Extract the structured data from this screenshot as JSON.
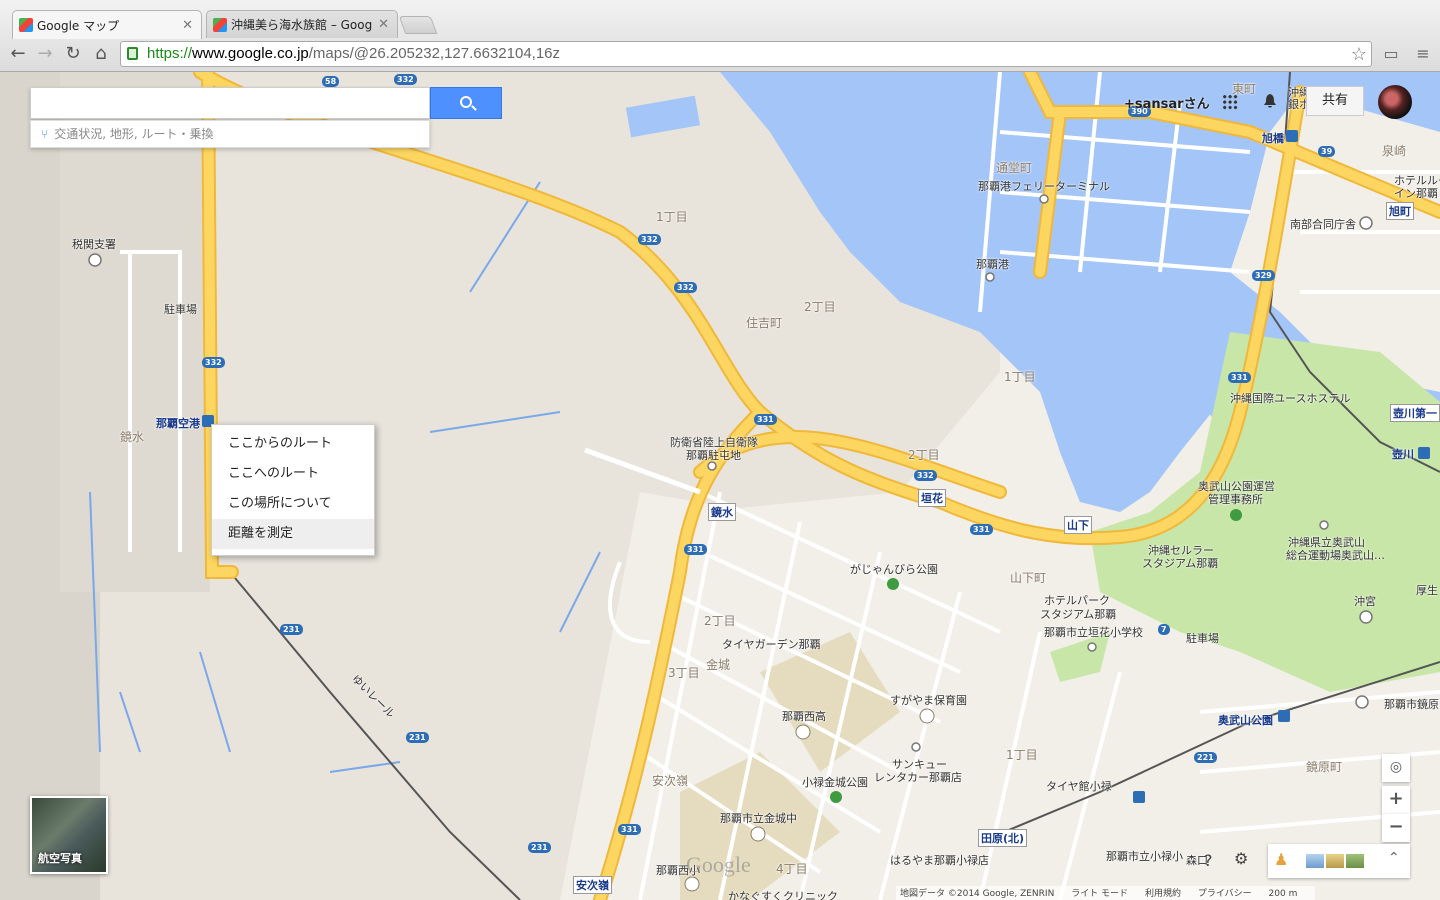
{
  "browser": {
    "tabs": [
      {
        "label": "Google マップ",
        "active": true
      },
      {
        "label": "沖縄美ら海水族館 – Google",
        "active": false
      }
    ],
    "url": {
      "scheme": "https://",
      "host": "www.google.co.jp",
      "path": "/maps/@26.205232,127.6632104,16z"
    },
    "nav": {
      "back": "←",
      "forward": "→",
      "reload": "↻",
      "home": "⌂",
      "star": "☆",
      "menu": "≡"
    }
  },
  "search": {
    "value": "",
    "sub_hint": "交通状況, 地形, ルート・乗換"
  },
  "user": {
    "name": "+sansarさん",
    "share_label": "共有"
  },
  "context_menu": {
    "items": [
      "ここからのルート",
      "ここへのルート",
      "この場所について",
      "距離を測定"
    ]
  },
  "map_labels": {
    "places": [
      "税関支署",
      "駐車場",
      "那覇空港",
      "鏡水",
      "防衛省陸上自衛隊",
      "那覇駐屯地",
      "鏡水",
      "1丁目",
      "2丁目",
      "住吉町",
      "1丁目",
      "2丁目",
      "那覇港",
      "那覇港フェリーターミナル",
      "通堂町",
      "垣花",
      "山下",
      "がじゃんびら公園",
      "ホテルパーク",
      "スタジアム那覇",
      "那覇市立垣花小学校",
      "山下町",
      "タイヤガーデン那覇",
      "金城",
      "3丁目",
      "2丁目",
      "那覇西高",
      "すがやま保育園",
      "サンキュー",
      "レンタカー那覇店",
      "小禄金城公園",
      "安次嶺",
      "那覇市立金城中",
      "1丁目",
      "4丁目",
      "タイヤ館小禄",
      "那覇市立小禄小",
      "はるやま那覇小禄店",
      "田原(北)",
      "那覇西小",
      "かなぐすくクリニック",
      "安次嶺",
      "奥武山公園",
      "奥武山公園運営",
      "管理事務所",
      "沖縄セルラー",
      "スタジアム那覇",
      "沖縄県立奥武山",
      "総合運動場奥武山…",
      "沖宮",
      "駐車場",
      "沖縄国際ユースホステル",
      "壺川第一",
      "壺川",
      "旭橋",
      "南部合同庁舎",
      "旭町",
      "泉崎",
      "那覇市鏡原",
      "鏡原町",
      "森口",
      "ゆいレール",
      "ホテルルー",
      "イン那覇",
      "厚生",
      "東町",
      "沖縄か",
      "銀ホテ"
    ],
    "roads": [
      "332",
      "332",
      "332",
      "332",
      "58",
      "331",
      "331",
      "331",
      "331",
      "331",
      "231",
      "231",
      "231",
      "329",
      "390",
      "39",
      "7",
      "221",
      "332"
    ]
  },
  "controls": {
    "aerial_label": "航空写真",
    "zoom_in": "+",
    "zoom_out": "−",
    "help": "?",
    "settings": "⚙",
    "expand": "⌃"
  },
  "footer": {
    "data": "地図データ ©2014 Google, ZENRIN",
    "lite": "ライト モード",
    "terms": "利用規約",
    "privacy": "プライバシー",
    "scale": "200 m"
  },
  "colors": {
    "water": "#a4c5f7",
    "road_major": "#fcd661",
    "road_outline": "#f0b83a",
    "land": "#e8e4dc",
    "urban": "#f2efe9",
    "park": "#c8e6a8",
    "search_blue": "#4d90fe"
  }
}
